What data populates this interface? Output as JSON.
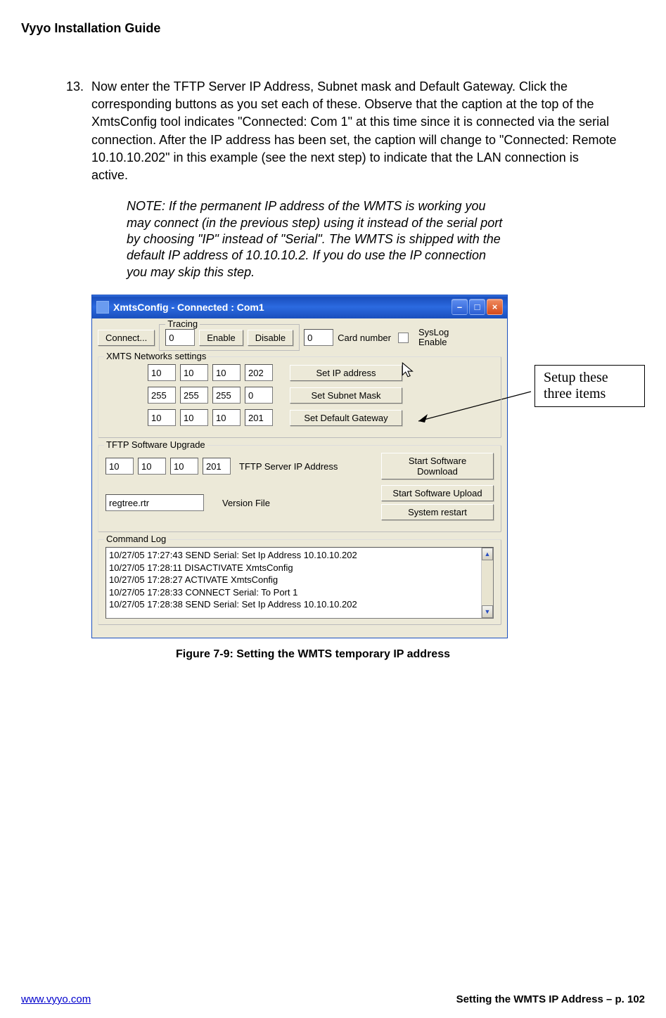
{
  "header": {
    "title": "Vyyo Installation Guide"
  },
  "step": {
    "number": "13.",
    "text": "Now enter the TFTP Server IP Address, Subnet mask and Default Gateway. Click the corresponding buttons as you set each of these. Observe that the caption at the top of the XmtsConfig tool indicates \"Connected: Com 1\" at this time since it is connected via the serial connection.  After the IP address has been set, the caption will change to \"Connected: Remote 10.10.10.202\" in this example (see the next step) to indicate that the LAN connection is active."
  },
  "note": "NOTE:  If the permanent IP address of the WMTS is working you may connect (in the previous step) using it instead of the serial port by choosing \"IP\" instead of \"Serial\".  The WMTS is shipped with the default IP address of 10.10.10.2. If you do use the IP connection you may skip this step.",
  "annotation": "Setup these three items",
  "window": {
    "title": "XmtsConfig - Connected : Com1",
    "toolbar": {
      "connect": "Connect...",
      "tracing_legend": "Tracing",
      "tracing_value": "0",
      "enable": "Enable",
      "disable": "Disable",
      "card_number_value": "0",
      "card_number_label": "Card number",
      "syslog_label_l1": "SysLog",
      "syslog_label_l2": "Enable"
    },
    "xmts": {
      "legend": "XMTS Networks settings",
      "ip": [
        "10",
        "10",
        "10",
        "202"
      ],
      "ip_btn": "Set IP address",
      "subnet": [
        "255",
        "255",
        "255",
        "0"
      ],
      "subnet_btn": "Set Subnet Mask",
      "gateway": [
        "10",
        "10",
        "10",
        "201"
      ],
      "gateway_btn": "Set Default Gateway"
    },
    "tftp": {
      "legend": "TFTP Software Upgrade",
      "server": [
        "10",
        "10",
        "10",
        "201"
      ],
      "server_label": "TFTP Server IP Address",
      "download_btn": "Start Software Download",
      "upload_btn": "Start Software Upload",
      "version_file": "regtree.rtr",
      "version_label": "Version File",
      "restart_btn": "System restart"
    },
    "log": {
      "legend": "Command Log",
      "lines": [
        "10/27/05 17:27:43 SEND Serial: Set Ip Address 10.10.10.202",
        "10/27/05 17:28:11 DISACTIVATE XmtsConfig",
        "10/27/05 17:28:27 ACTIVATE XmtsConfig",
        "10/27/05 17:28:33 CONNECT Serial: To Port 1",
        "10/27/05 17:28:38 SEND Serial: Set Ip Address 10.10.10.202"
      ]
    }
  },
  "figure_caption": "Figure 7-9:  Setting the WMTS temporary IP address",
  "footer": {
    "url": "www.vyyo.com",
    "right": "Setting the WMTS IP Address – p. 102"
  }
}
